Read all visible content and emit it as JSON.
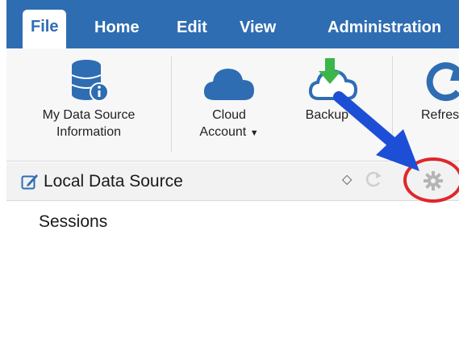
{
  "menu": {
    "tabs": [
      {
        "label": "File"
      },
      {
        "label": "Home"
      },
      {
        "label": "Edit"
      },
      {
        "label": "View"
      },
      {
        "label": "Administration"
      }
    ]
  },
  "ribbon": {
    "data_source_info": {
      "line1": "My Data Source",
      "line2": "Information"
    },
    "cloud_account": {
      "line1": "Cloud",
      "line2": "Account"
    },
    "backup": {
      "label": "Backup"
    },
    "refresh": {
      "label": "Refresh"
    }
  },
  "data_source_bar": {
    "title": "Local Data Source",
    "stepper_glyph": "◇"
  },
  "content": {
    "sessions_label": "Sessions"
  },
  "colors": {
    "accent": "#2f6db3",
    "arrow": "#1d4fd6",
    "callout": "#e0262b",
    "backup_arrow": "#3cb54a"
  },
  "icons": [
    "database-info-icon",
    "cloud-icon",
    "cloud-backup-icon",
    "refresh-icon",
    "edit-icon",
    "stepper-icon",
    "refresh-small-icon",
    "gear-icon"
  ]
}
